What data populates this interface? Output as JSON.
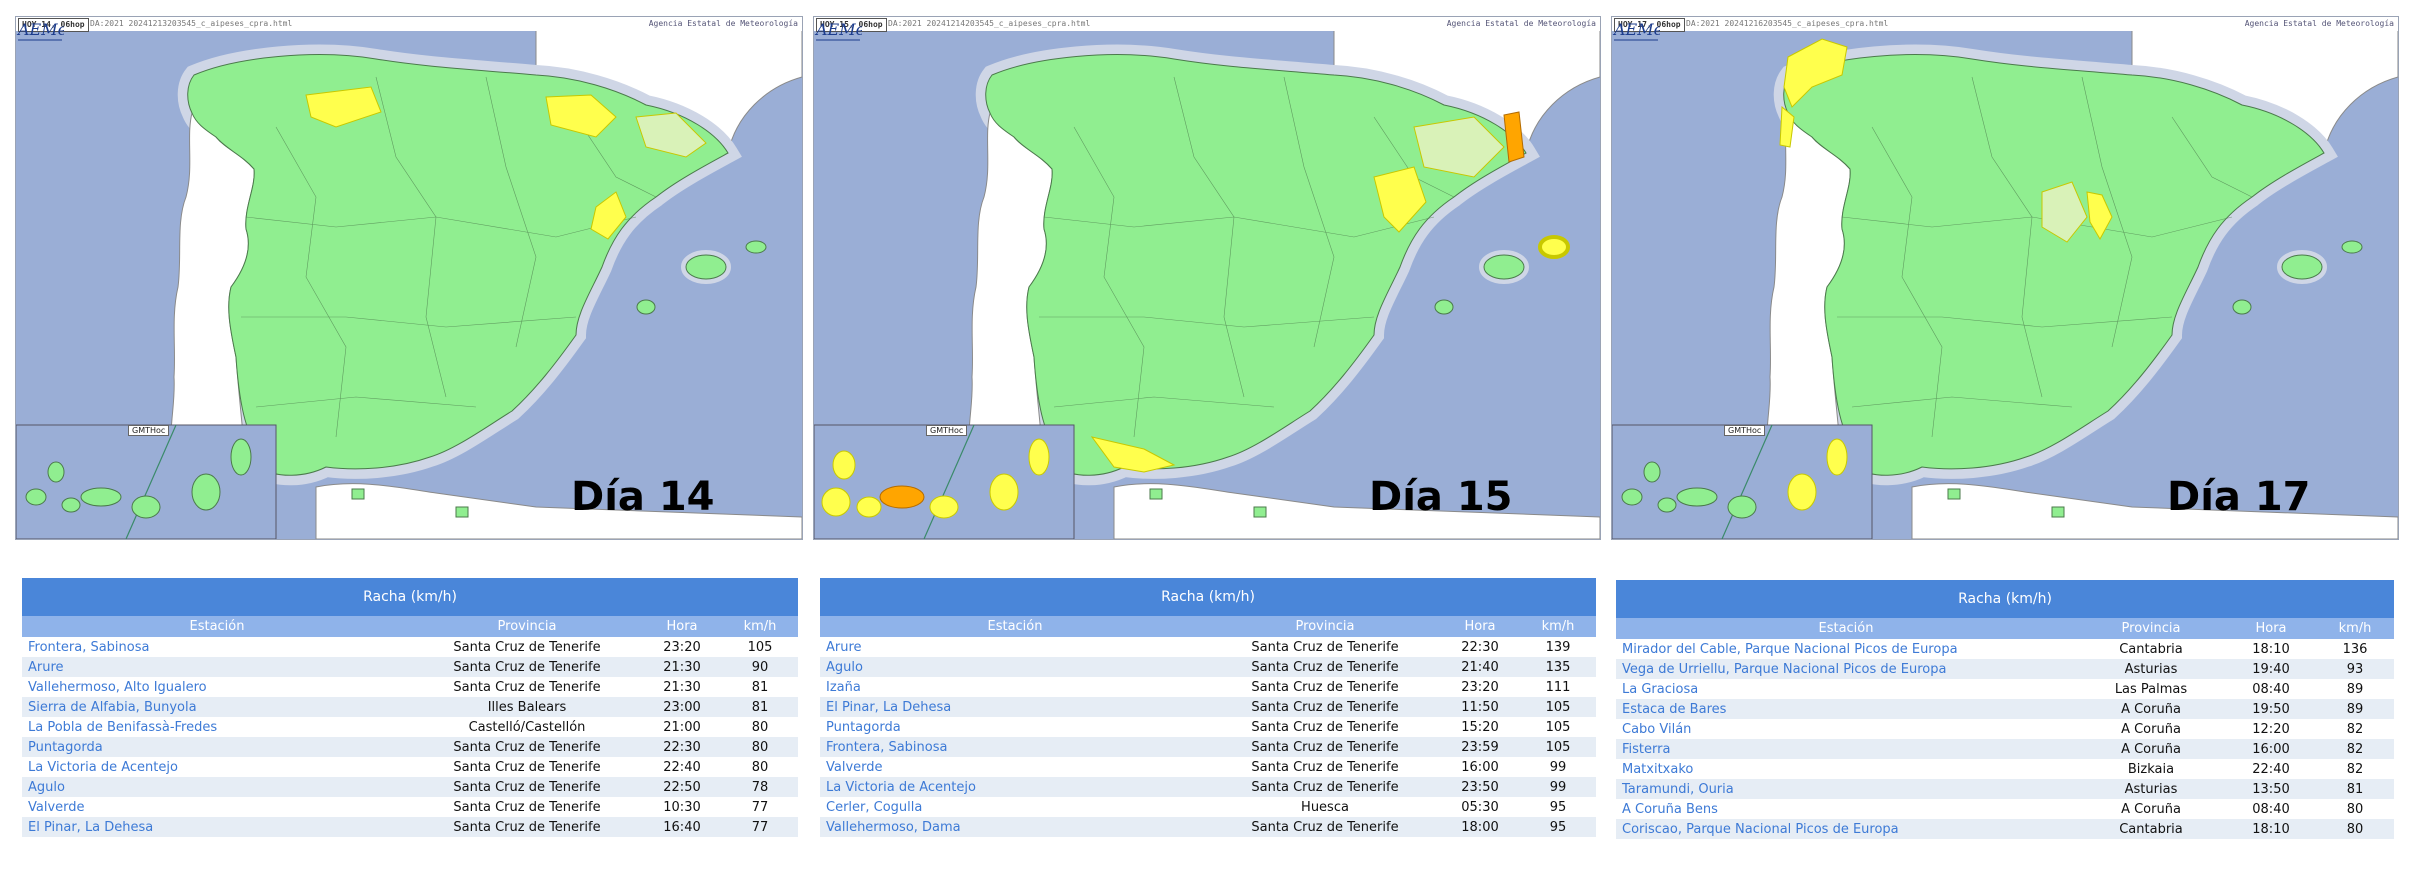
{
  "colors": {
    "sea": "#9aaed6",
    "land_foreign": "#ffffff",
    "no_warning": "#90ee90",
    "yellow": "#ffff4d",
    "orange": "#ffa500",
    "table_title_bg": "#4a86d9",
    "table_header_bg": "#8fb3ea",
    "station_link": "#3d7ad6"
  },
  "panels": [
    {
      "map": {
        "date_label": "HOY 14, 06hop",
        "file_label": "DA:2021  20241213203545_c_aipeses_cpra.html",
        "agency_label": "Agencia Estatal de Meteorología",
        "day_label": "Día 14",
        "logo_text": "AEMet",
        "canary_tag": "GMTHoc"
      },
      "table": {
        "title": "Racha (km/h)",
        "headers": [
          "Estación",
          "Provincia",
          "Hora",
          "km/h"
        ],
        "rows": [
          {
            "estacion": "Frontera, Sabinosa",
            "provincia": "Santa Cruz de Tenerife",
            "hora": "23:20",
            "kmh": "105"
          },
          {
            "estacion": "Arure",
            "provincia": "Santa Cruz de Tenerife",
            "hora": "21:30",
            "kmh": "90"
          },
          {
            "estacion": "Vallehermoso, Alto Igualero",
            "provincia": "Santa Cruz de Tenerife",
            "hora": "21:30",
            "kmh": "81"
          },
          {
            "estacion": "Sierra de Alfabia, Bunyola",
            "provincia": "Illes Balears",
            "hora": "23:00",
            "kmh": "81"
          },
          {
            "estacion": "La Pobla de Benifassà-Fredes",
            "provincia": "Castelló/Castellón",
            "hora": "21:00",
            "kmh": "80"
          },
          {
            "estacion": "Puntagorda",
            "provincia": "Santa Cruz de Tenerife",
            "hora": "22:30",
            "kmh": "80"
          },
          {
            "estacion": "La Victoria de Acentejo",
            "provincia": "Santa Cruz de Tenerife",
            "hora": "22:40",
            "kmh": "80"
          },
          {
            "estacion": "Agulo",
            "provincia": "Santa Cruz de Tenerife",
            "hora": "22:50",
            "kmh": "78"
          },
          {
            "estacion": "Valverde",
            "provincia": "Santa Cruz de Tenerife",
            "hora": "10:30",
            "kmh": "77"
          },
          {
            "estacion": "El Pinar, La Dehesa",
            "provincia": "Santa Cruz de Tenerife",
            "hora": "16:40",
            "kmh": "77"
          }
        ]
      }
    },
    {
      "map": {
        "date_label": "HOY 15, 06hop",
        "file_label": "DA:2021  20241214203545_c_aipeses_cpra.html",
        "agency_label": "Agencia Estatal de Meteorología",
        "day_label": "Día 15",
        "logo_text": "AEMet",
        "canary_tag": "GMTHoc"
      },
      "table": {
        "title": "Racha (km/h)",
        "headers": [
          "Estación",
          "Provincia",
          "Hora",
          "km/h"
        ],
        "rows": [
          {
            "estacion": "Arure",
            "provincia": "Santa Cruz de Tenerife",
            "hora": "22:30",
            "kmh": "139"
          },
          {
            "estacion": "Agulo",
            "provincia": "Santa Cruz de Tenerife",
            "hora": "21:40",
            "kmh": "135"
          },
          {
            "estacion": "Izaña",
            "provincia": "Santa Cruz de Tenerife",
            "hora": "23:20",
            "kmh": "111"
          },
          {
            "estacion": "El Pinar, La Dehesa",
            "provincia": "Santa Cruz de Tenerife",
            "hora": "11:50",
            "kmh": "105"
          },
          {
            "estacion": "Puntagorda",
            "provincia": "Santa Cruz de Tenerife",
            "hora": "15:20",
            "kmh": "105"
          },
          {
            "estacion": "Frontera, Sabinosa",
            "provincia": "Santa Cruz de Tenerife",
            "hora": "23:59",
            "kmh": "105"
          },
          {
            "estacion": "Valverde",
            "provincia": "Santa Cruz de Tenerife",
            "hora": "16:00",
            "kmh": "99"
          },
          {
            "estacion": "La Victoria de Acentejo",
            "provincia": "Santa Cruz de Tenerife",
            "hora": "23:50",
            "kmh": "99"
          },
          {
            "estacion": "Cerler, Cogulla",
            "provincia": "Huesca",
            "hora": "05:30",
            "kmh": "95"
          },
          {
            "estacion": "Vallehermoso, Dama",
            "provincia": "Santa Cruz de Tenerife",
            "hora": "18:00",
            "kmh": "95"
          }
        ]
      }
    },
    {
      "map": {
        "date_label": "HOY 17, 06hop",
        "file_label": "DA:2021  20241216203545_c_aipeses_cpra.html",
        "agency_label": "Agencia Estatal de Meteorología",
        "day_label": "Día 17",
        "logo_text": "AEMet",
        "canary_tag": "GMTHoc"
      },
      "table": {
        "title": "Racha (km/h)",
        "headers": [
          "Estación",
          "Provincia",
          "Hora",
          "km/h"
        ],
        "rows": [
          {
            "estacion": "Mirador del Cable, Parque Nacional Picos de Europa",
            "provincia": "Cantabria",
            "hora": "18:10",
            "kmh": "136"
          },
          {
            "estacion": "Vega de Urriellu, Parque Nacional Picos de Europa",
            "provincia": "Asturias",
            "hora": "19:40",
            "kmh": "93"
          },
          {
            "estacion": "La Graciosa",
            "provincia": "Las Palmas",
            "hora": "08:40",
            "kmh": "89"
          },
          {
            "estacion": "Estaca de Bares",
            "provincia": "A Coruña",
            "hora": "19:50",
            "kmh": "89"
          },
          {
            "estacion": "Cabo Vilán",
            "provincia": "A Coruña",
            "hora": "12:20",
            "kmh": "82"
          },
          {
            "estacion": "Fisterra",
            "provincia": "A Coruña",
            "hora": "16:00",
            "kmh": "82"
          },
          {
            "estacion": "Matxitxako",
            "provincia": "Bizkaia",
            "hora": "22:40",
            "kmh": "82"
          },
          {
            "estacion": "Taramundi, Ouria",
            "provincia": "Asturias",
            "hora": "13:50",
            "kmh": "81"
          },
          {
            "estacion": "A Coruña Bens",
            "provincia": "A Coruña",
            "hora": "08:40",
            "kmh": "80"
          },
          {
            "estacion": "Coriscao, Parque Nacional Picos de Europa",
            "provincia": "Cantabria",
            "hora": "18:10",
            "kmh": "80"
          }
        ]
      }
    }
  ]
}
